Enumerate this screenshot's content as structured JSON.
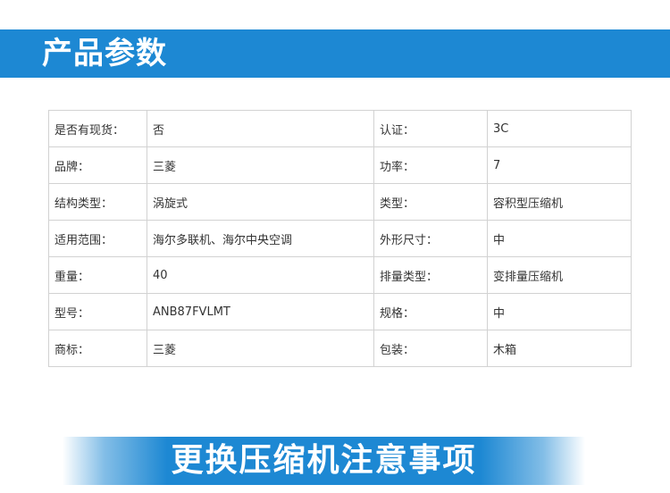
{
  "header": {
    "title": "产品参数"
  },
  "params": {
    "rows": [
      {
        "label1": "是否有现货：",
        "value1": "否",
        "label2": "认证：",
        "value2": "3C"
      },
      {
        "label1": "品牌：",
        "value1": "三菱",
        "label2": "功率：",
        "value2": "7"
      },
      {
        "label1": "结构类型：",
        "value1": "涡旋式",
        "label2": "类型：",
        "value2": "容积型压缩机"
      },
      {
        "label1": "适用范围：",
        "value1": "海尔多联机、海尔中央空调",
        "label2": "外形尺寸：",
        "value2": "中"
      },
      {
        "label1": "重量：",
        "value1": "40",
        "label2": "排量类型：",
        "value2": "变排量压缩机"
      },
      {
        "label1": "型号：",
        "value1": "ANB87FVLMT",
        "label2": "规格：",
        "value2": "中"
      },
      {
        "label1": "商标：",
        "value1": "三菱",
        "label2": "包装：",
        "value2": "木箱"
      }
    ]
  },
  "footer": {
    "title": "更换压缩机注意事项"
  },
  "colors": {
    "brand_blue": "#1d88d3",
    "border": "#d2d2d2",
    "text": "#333333"
  }
}
